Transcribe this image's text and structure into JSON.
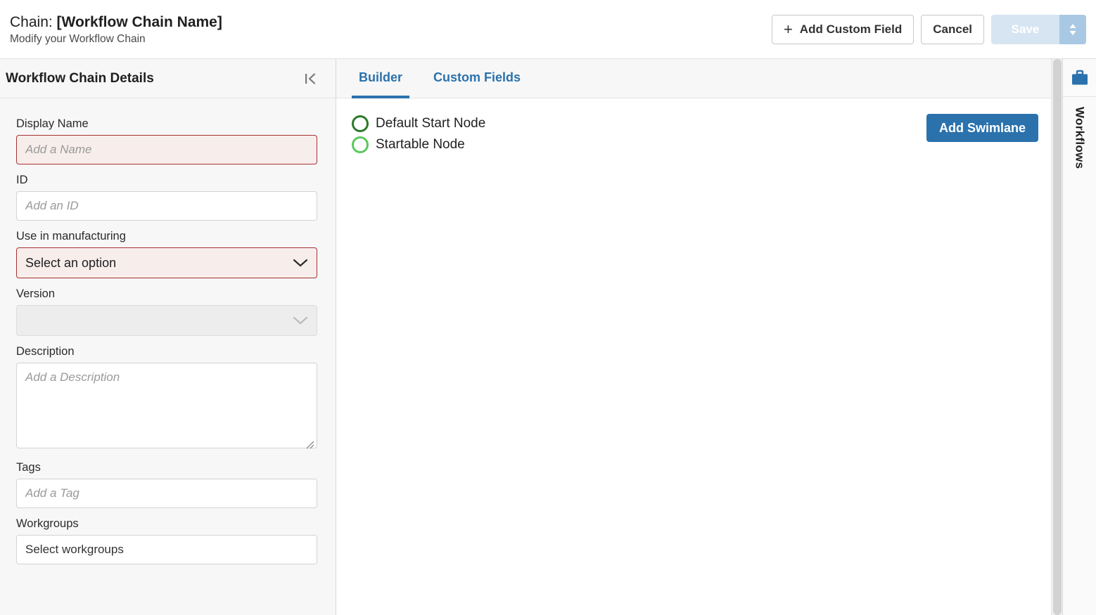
{
  "header": {
    "title_prefix": "Chain: ",
    "title_name": "[Workflow Chain Name]",
    "subtitle": "Modify your Workflow Chain",
    "add_custom_field_label": "Add Custom Field",
    "cancel_label": "Cancel",
    "save_label": "Save"
  },
  "sidebar": {
    "title": "Workflow Chain Details",
    "collapse_icon": "collapse-left-icon",
    "fields": {
      "display_name": {
        "label": "Display Name",
        "placeholder": "Add a Name",
        "value": ""
      },
      "id": {
        "label": "ID",
        "placeholder": "Add an ID",
        "value": ""
      },
      "use_in_manufacturing": {
        "label": "Use in manufacturing",
        "value": "Select an option"
      },
      "version": {
        "label": "Version",
        "value": ""
      },
      "description": {
        "label": "Description",
        "placeholder": "Add a Description",
        "value": ""
      },
      "tags": {
        "label": "Tags",
        "placeholder": "Add a Tag",
        "value": ""
      },
      "workgroups": {
        "label": "Workgroups",
        "value": "Select workgroups"
      }
    }
  },
  "main": {
    "tabs": [
      {
        "label": "Builder",
        "active": true
      },
      {
        "label": "Custom Fields",
        "active": false
      }
    ],
    "legend": [
      {
        "label": "Default Start Node",
        "color": "#2a7a2a"
      },
      {
        "label": "Startable Node",
        "color": "#5cc75c"
      }
    ],
    "add_swimlane_label": "Add Swimlane"
  },
  "right_rail": {
    "icon": "briefcase-icon",
    "label": "Workflows"
  },
  "colors": {
    "accent_blue": "#2b72ad",
    "error_red": "#a83232",
    "error_bg": "#f7eeec",
    "save_disabled": "#d7e5f2",
    "save_toggle": "#a9c8e3",
    "sidebar_bg": "#f7f7f7",
    "dark_green": "#2a7a2a",
    "light_green": "#5cc75c"
  }
}
